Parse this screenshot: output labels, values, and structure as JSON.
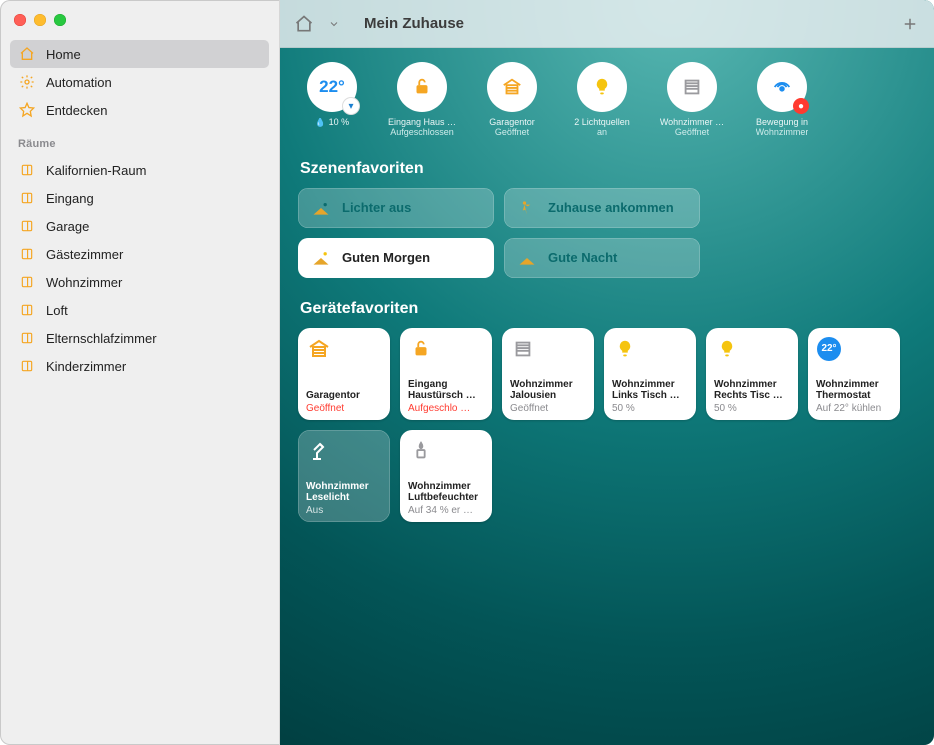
{
  "header": {
    "title": "Mein Zuhause"
  },
  "sidebar": {
    "main": [
      {
        "label": "Home",
        "icon": "house-icon",
        "selected": true
      },
      {
        "label": "Automation",
        "icon": "gear-icon",
        "selected": false
      },
      {
        "label": "Entdecken",
        "icon": "star-icon",
        "selected": false
      }
    ],
    "section_label": "Räume",
    "rooms": [
      {
        "label": "Kalifornien-Raum"
      },
      {
        "label": "Eingang"
      },
      {
        "label": "Garage"
      },
      {
        "label": "Gästezimmer"
      },
      {
        "label": "Wohnzimmer"
      },
      {
        "label": "Loft"
      },
      {
        "label": "Elternschlafzimmer"
      },
      {
        "label": "Kinderzimmer"
      }
    ]
  },
  "status": [
    {
      "icon": "temperature-icon",
      "main": "22°",
      "line1": "10 %",
      "line2": "",
      "badge": "down"
    },
    {
      "icon": "lock-open-icon",
      "line1": "Eingang Haus …",
      "line2": "Aufgeschlossen"
    },
    {
      "icon": "garage-icon",
      "line1": "Garagentor",
      "line2": "Geöffnet"
    },
    {
      "icon": "bulb-icon",
      "line1": "2 Lichtquellen",
      "line2": "an"
    },
    {
      "icon": "blinds-icon",
      "line1": "Wohnzimmer …",
      "line2": "Geöffnet"
    },
    {
      "icon": "motion-icon",
      "line1": "Bewegung in",
      "line2": "Wohnzimmer",
      "badge": "alert"
    }
  ],
  "scenes": {
    "title": "Szenenfavoriten",
    "items": [
      {
        "label": "Lichter aus",
        "icon": "house-moon-icon",
        "active": false
      },
      {
        "label": "Zuhause ankommen",
        "icon": "person-arrive-icon",
        "active": false
      },
      {
        "label": "Guten Morgen",
        "icon": "house-sun-icon",
        "active": true
      },
      {
        "label": "Gute Nacht",
        "icon": "house-moon-icon",
        "active": false
      }
    ]
  },
  "devices": {
    "title": "Gerätefavoriten",
    "items": [
      {
        "name": "Garagentor",
        "state": "Geöffnet",
        "state_color": "red",
        "icon": "garage-icon",
        "off": false
      },
      {
        "name": "Eingang Haustürsch …",
        "state": "Aufgeschlo …",
        "state_color": "red",
        "icon": "lock-open-icon",
        "off": false
      },
      {
        "name": "Wohnzimmer Jalousien",
        "state": "Geöffnet",
        "state_color": "gray",
        "icon": "blinds-icon",
        "off": false
      },
      {
        "name": "Wohnzimmer Links Tisch …",
        "state": "50 %",
        "state_color": "gray",
        "icon": "bulb-icon",
        "off": false
      },
      {
        "name": "Wohnzimmer Rechts Tisc …",
        "state": "50 %",
        "state_color": "gray",
        "icon": "bulb-icon",
        "off": false
      },
      {
        "name": "Wohnzimmer Thermostat",
        "state": "Auf 22° kühlen",
        "state_color": "gray",
        "icon": "thermo-icon",
        "off": false,
        "pill": "22°"
      },
      {
        "name": "Wohnzimmer Leselicht",
        "state": "Aus",
        "state_color": "gray",
        "icon": "lamp-icon",
        "off": true
      },
      {
        "name": "Wohnzimmer Luftbefeuchter",
        "state": "Auf 34 % er …",
        "state_color": "gray",
        "icon": "humidifier-icon",
        "off": false
      }
    ]
  }
}
